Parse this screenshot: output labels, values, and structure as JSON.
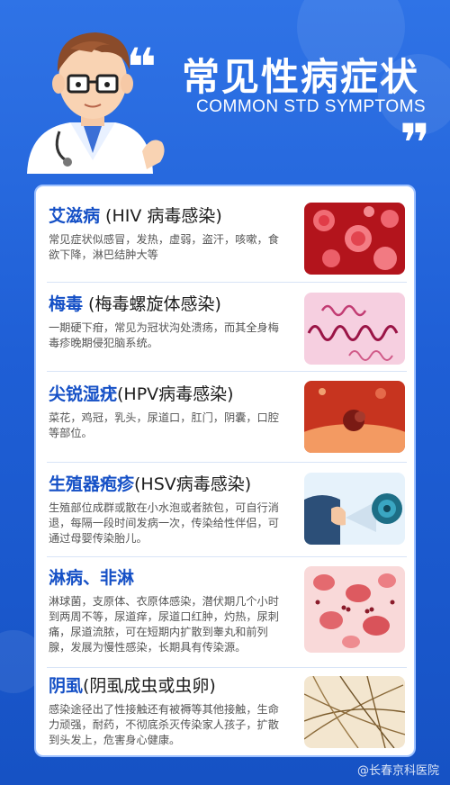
{
  "header": {
    "title_zh": "常见性病症状",
    "title_en": "COMMON STD SYMPTOMS",
    "quote_open": "❝",
    "quote_close": "❞"
  },
  "items": [
    {
      "title_main": "艾滋病",
      "title_sub": " (HIV 病毒感染)",
      "desc": "常见症状似感冒，发热，虚弱，盗汗，咳嗽，食欲下降，淋巴结肿大等",
      "image": "red-virus-particles"
    },
    {
      "title_main": "梅毒",
      "title_sub": " (梅毒螺旋体感染)",
      "desc": "一期硬下疳，常见为冠状沟处溃疡，而其全身梅毒疹晚期侵犯脑系统。",
      "image": "spirochete-bacteria"
    },
    {
      "title_main": "尖锐湿疣",
      "title_sub": "(HPV病毒感染)",
      "desc": "菜花，鸡冠，乳头，尿道口，肛门，阴囊，口腔等部位。",
      "image": "hpv-virus-cells"
    },
    {
      "title_main": "生殖器疱疹",
      "title_sub": "(HSV病毒感染)",
      "desc": "生殖部位成群或散在小水泡或者脓包，可自行消退，每隔一段时间发病一次，传染给性伴侣，可通过母婴传染胎儿。",
      "image": "hsv-illustration"
    },
    {
      "title_main": "淋病、非淋",
      "title_sub": "",
      "desc": "淋球菌，支原体、衣原体感染，潜伏期几个小时到两周不等，尿道痒，尿道口红肿，灼热，尿刺痛，尿道流脓，可在短期内扩散到睾丸和前列腺，发展为慢性感染，长期具有传染源。",
      "image": "gonococcus-smear"
    },
    {
      "title_main": "阴虱",
      "title_sub": "(阴虱成虫或虫卵)",
      "desc": "感染途径出了性接触还有被褥等其他接触，生命力顽强，耐药，不彻底杀灭传染家人孩子，扩散到头发上，危害身心健康。",
      "image": "hair-lice"
    }
  ],
  "watermark": "@长春京科医院",
  "colors": {
    "background": "#2f73e6",
    "title_blue": "#1550c6",
    "card": "#ffffff"
  }
}
